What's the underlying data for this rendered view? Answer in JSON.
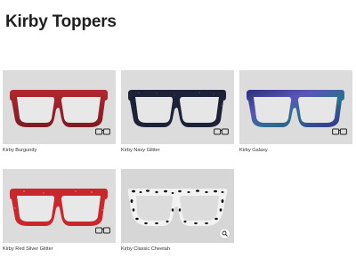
{
  "page": {
    "title": "Kirby Toppers"
  },
  "products": [
    {
      "name": "Kirby Burgundy",
      "frame_color": "#a2222b",
      "pattern": "solid",
      "icon": "glasses-icon"
    },
    {
      "name": "Kirby Navy Glitter",
      "frame_color": "#1d2238",
      "pattern": "glitter",
      "icon": "glasses-icon"
    },
    {
      "name": "Kirby Galaxy",
      "frame_color": "#3b3c8e",
      "pattern": "galaxy",
      "icon": "glasses-icon"
    },
    {
      "name": "Kirby Red Silver Glitter",
      "frame_color": "#c9272c",
      "pattern": "glitter",
      "icon": "glasses-icon"
    },
    {
      "name": "Kirby Classic Cheetah",
      "frame_color": "#f2f2f2",
      "pattern": "cheetah",
      "icon": "quick-view-icon"
    }
  ],
  "colors": {
    "thumb_background": "#dcdcdc",
    "text": "#1f1f1f"
  }
}
